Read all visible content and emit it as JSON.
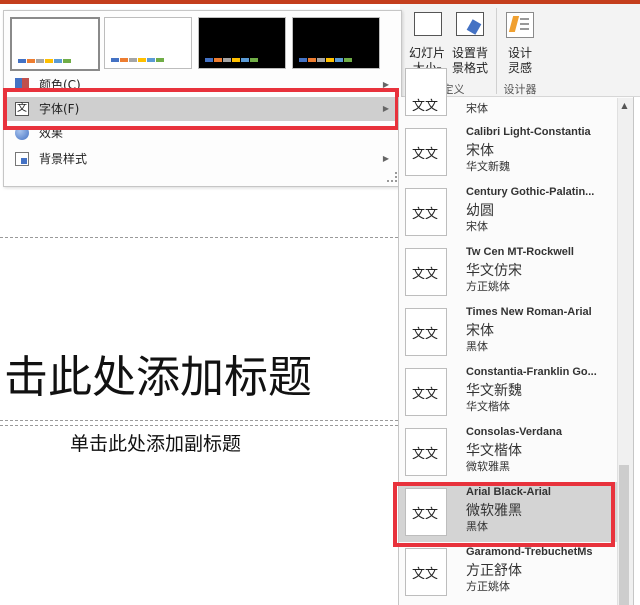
{
  "colors": {
    "accent": "#c43e1c",
    "highlight": "#e8323c",
    "selected": "#cfcfcf"
  },
  "variants": [
    {
      "bg": "#ffffff",
      "bars": [
        "#4472c4",
        "#ed7d31",
        "#a5a5a5",
        "#ffc000",
        "#5b9bd5",
        "#70ad47"
      ]
    },
    {
      "bg": "#ffffff",
      "bars": [
        "#4472c4",
        "#ed7d31",
        "#a5a5a5",
        "#ffc000",
        "#5b9bd5",
        "#70ad47"
      ]
    },
    {
      "bg": "#000000",
      "bars": [
        "#4472c4",
        "#ed7d31",
        "#a5a5a5",
        "#ffc000",
        "#5b9bd5",
        "#70ad47"
      ]
    },
    {
      "bg": "#000000",
      "bars": [
        "#4472c4",
        "#ed7d31",
        "#a5a5a5",
        "#ffc000",
        "#5b9bd5",
        "#70ad47"
      ]
    }
  ],
  "menu": {
    "colors_label": "颜色(C)",
    "fonts_label": "字体(F)",
    "effects_label": "效果",
    "background_label": "背景样式",
    "arrow": "▶"
  },
  "ribbon": {
    "slide_size_line1": "幻灯片",
    "slide_size_line2": "大小",
    "slide_size_dropdown": "▾",
    "format_bg_line1": "设置背",
    "format_bg_line2": "景格式",
    "designer_line1": "设计",
    "designer_line2": "灵感",
    "customize_group": "自定义",
    "designer_group": "设计器"
  },
  "slide": {
    "title_placeholder": "击此处添加标题",
    "subtitle_placeholder": "单击此处添加副标题"
  },
  "font_gallery": {
    "partial_top_thumb": "文文",
    "partial_top_body": "宋体",
    "scroll_up": "▲",
    "items": [
      {
        "name": "Calibri Light-Constantia",
        "heading": "宋体",
        "body": "华文新魏",
        "thumb": "文文"
      },
      {
        "name": "Century Gothic-Palatin...",
        "heading": "幼圆",
        "body": "宋体",
        "thumb": "文文"
      },
      {
        "name": "Tw Cen MT-Rockwell",
        "heading": "华文仿宋",
        "body": "方正姚体",
        "thumb": "文文"
      },
      {
        "name": "Times New Roman-Arial",
        "heading": "宋体",
        "body": "黑体",
        "thumb": "文文"
      },
      {
        "name": "Constantia-Franklin Go...",
        "heading": "华文新魏",
        "body": "华文楷体",
        "thumb": "文文"
      },
      {
        "name": "Consolas-Verdana",
        "heading": "华文楷体",
        "body": "微软雅黑",
        "thumb": "文文"
      },
      {
        "name": "Arial Black-Arial",
        "heading": "微软雅黑",
        "body": "黑体",
        "thumb": "文文"
      },
      {
        "name": "Garamond-TrebuchetMs",
        "heading": "方正舒体",
        "body": "方正姚体",
        "thumb": "文文"
      }
    ]
  }
}
